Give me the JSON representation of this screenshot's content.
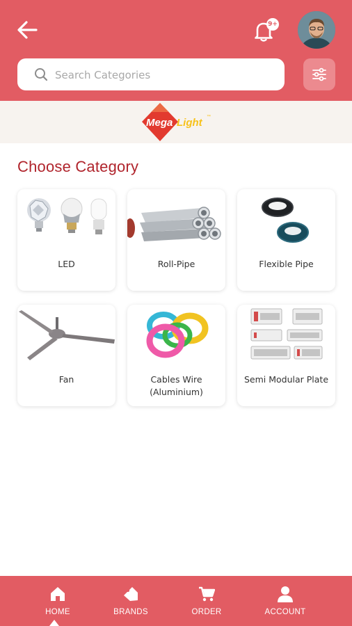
{
  "header": {
    "notification_badge": "9+",
    "search_placeholder": "Search Categories"
  },
  "brand": {
    "logo_text_1": "Mega",
    "logo_text_2": "Light",
    "logo_tm": "™"
  },
  "section_title": "Choose Category",
  "categories": [
    {
      "label": "LED",
      "icon": "led-bulbs-image"
    },
    {
      "label": "Roll-Pipe",
      "icon": "pipes-image"
    },
    {
      "label": "Flexible Pipe",
      "icon": "flexible-pipe-image"
    },
    {
      "label": "Fan",
      "icon": "ceiling-fan-image"
    },
    {
      "label": "Cables Wire (Aluminium)",
      "icon": "cable-coils-image"
    },
    {
      "label": "Semi Modular Plate",
      "icon": "switch-plates-image"
    }
  ],
  "nav": [
    {
      "label": "HOME",
      "icon": "home-icon",
      "active": true
    },
    {
      "label": "BRANDS",
      "icon": "tag-icon"
    },
    {
      "label": "ORDER",
      "icon": "cart-icon"
    },
    {
      "label": "ACCOUNT",
      "icon": "user-icon"
    }
  ],
  "colors": {
    "primary": "#e25c63",
    "title": "#b0242c",
    "logo_red": "#e23a2f",
    "logo_yellow": "#f7c21b"
  }
}
